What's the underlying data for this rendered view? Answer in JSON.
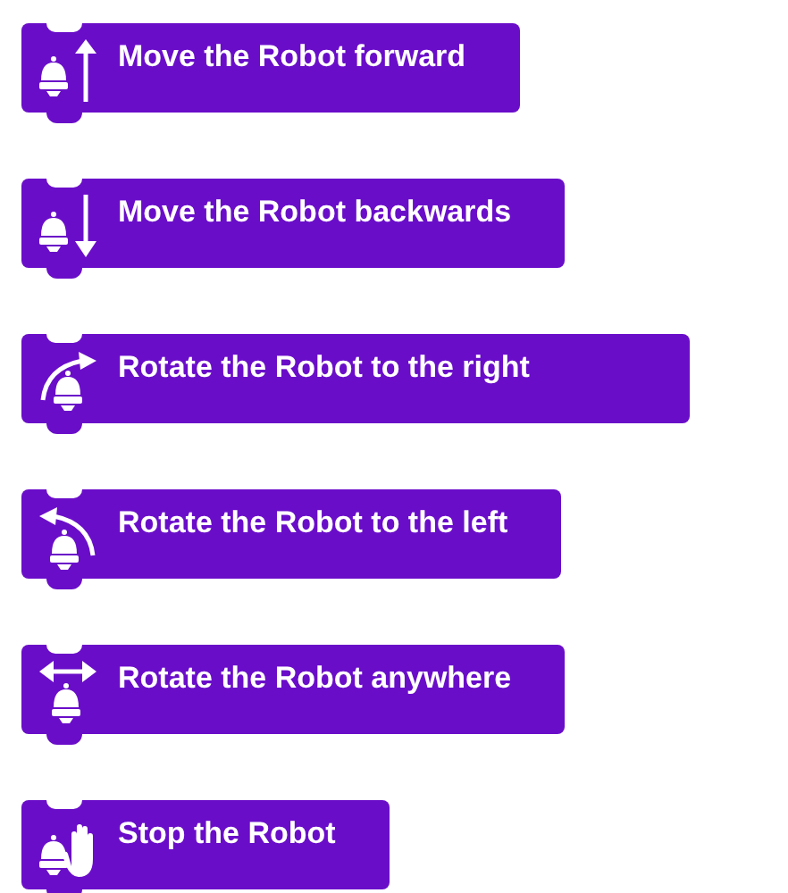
{
  "blocks": [
    {
      "kind": "forward",
      "label": "Move the Robot forward"
    },
    {
      "kind": "backward",
      "label": "Move the Robot backwards"
    },
    {
      "kind": "rotate-right",
      "label": "Rotate the Robot to the right"
    },
    {
      "kind": "rotate-left",
      "label": "Rotate the Robot to the left"
    },
    {
      "kind": "rotate-any",
      "label": "Rotate the Robot anywhere"
    },
    {
      "kind": "stop",
      "label": "Stop the Robot"
    }
  ]
}
